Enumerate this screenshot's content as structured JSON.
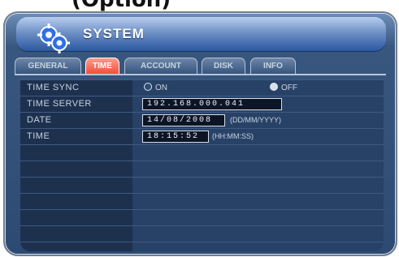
{
  "window": {
    "header_caption": "(Option)",
    "title": "SYSTEM",
    "icon": "gear-icon"
  },
  "tabs": [
    {
      "label": "GENERAL",
      "active": false
    },
    {
      "label": "TIME",
      "active": true
    },
    {
      "label": "ACCOUNT",
      "active": false
    },
    {
      "label": "DISK",
      "active": false
    },
    {
      "label": "INFO",
      "active": false
    }
  ],
  "time_sync": {
    "label": "TIME SYNC",
    "on_label": "ON",
    "off_label": "OFF",
    "selected": "OFF"
  },
  "time_server": {
    "label": "TIME SERVER",
    "value": "192.168.000.041"
  },
  "date": {
    "label": "DATE",
    "value": "14/08/2008",
    "format": "(DD/MM/YYYY)"
  },
  "time": {
    "label": "TIME",
    "value": "18:15:52",
    "format": "(HH:MM:SS)"
  },
  "colors": {
    "accent_tab": "#f04f3b",
    "panel": "#2d4a72"
  }
}
